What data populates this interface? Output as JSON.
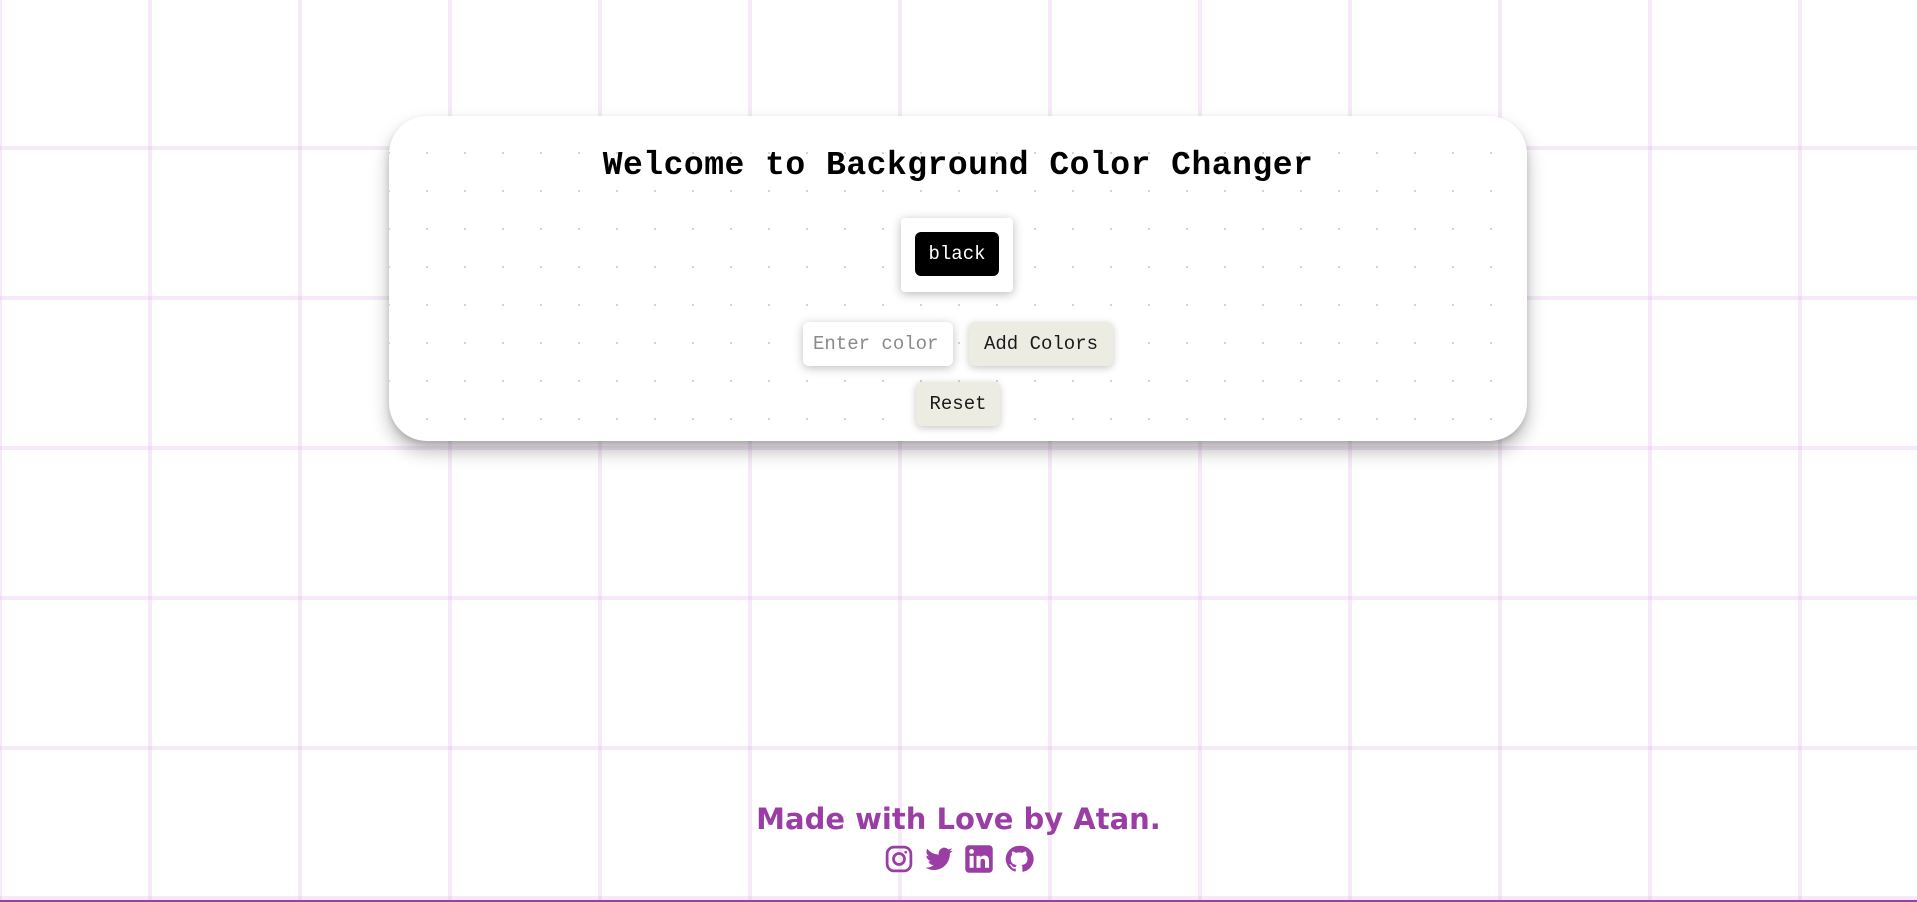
{
  "page": {
    "title": "Welcome to Background Color Changer"
  },
  "swatches": [
    {
      "label": "black",
      "color": "#000000"
    }
  ],
  "controls": {
    "color_input_placeholder": "Enter color",
    "color_input_value": "",
    "add_label": "Add Colors",
    "reset_label": "Reset"
  },
  "footer": {
    "credit": "Made with Love by Atan.",
    "socials": [
      {
        "icon": "instagram-icon"
      },
      {
        "icon": "twitter-icon"
      },
      {
        "icon": "linkedin-icon"
      },
      {
        "icon": "github-icon"
      }
    ]
  },
  "colors": {
    "accent": "#9a3ea6",
    "button_bg": "#ecece2",
    "card_bg": "#ffffff"
  }
}
